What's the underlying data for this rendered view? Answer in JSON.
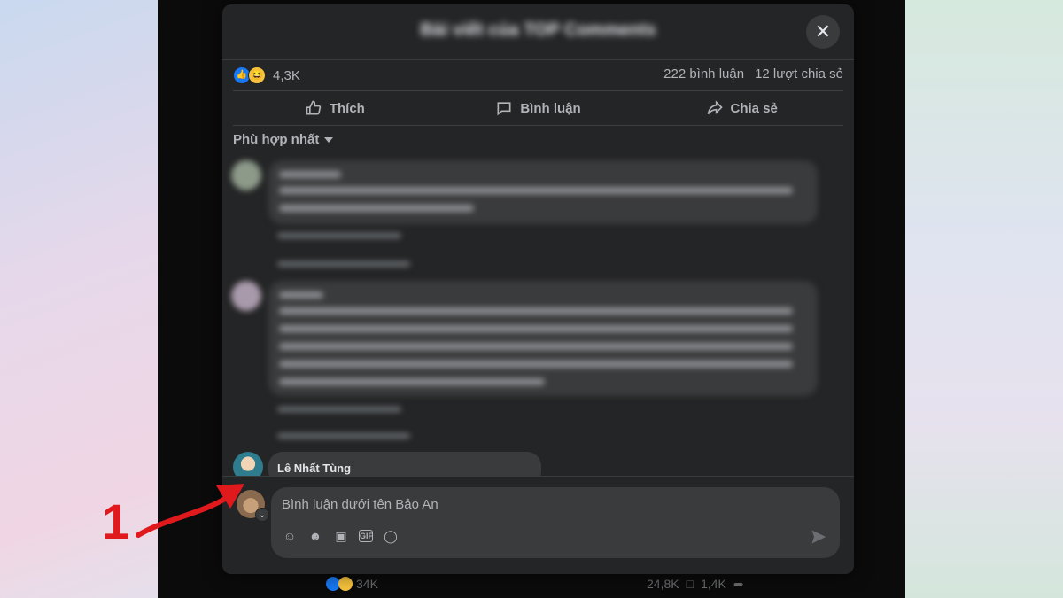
{
  "modal": {
    "title": "Bài viết của TOP Comments",
    "close_icon": "close-icon"
  },
  "stats": {
    "reaction_count": "4,3K",
    "comments": "222 bình luận",
    "shares": "12 lượt chia sẻ"
  },
  "actions": {
    "like": "Thích",
    "comment": "Bình luận",
    "share": "Chia sẻ"
  },
  "sort": {
    "label": "Phù hợp nhất"
  },
  "visible_comment": {
    "author": "Lê Nhất Tùng"
  },
  "composer": {
    "placeholder": "Bình luận dưới tên Bảo An",
    "tools": [
      "avatar-sticker-icon",
      "emoji-icon",
      "camera-icon",
      "gif-icon",
      "sticker-icon"
    ]
  },
  "background": {
    "reaction_count": "34K",
    "comments": "24,8K",
    "shares": "1,4K"
  },
  "annotation": {
    "step_number": "1",
    "color": "#e0191d"
  }
}
